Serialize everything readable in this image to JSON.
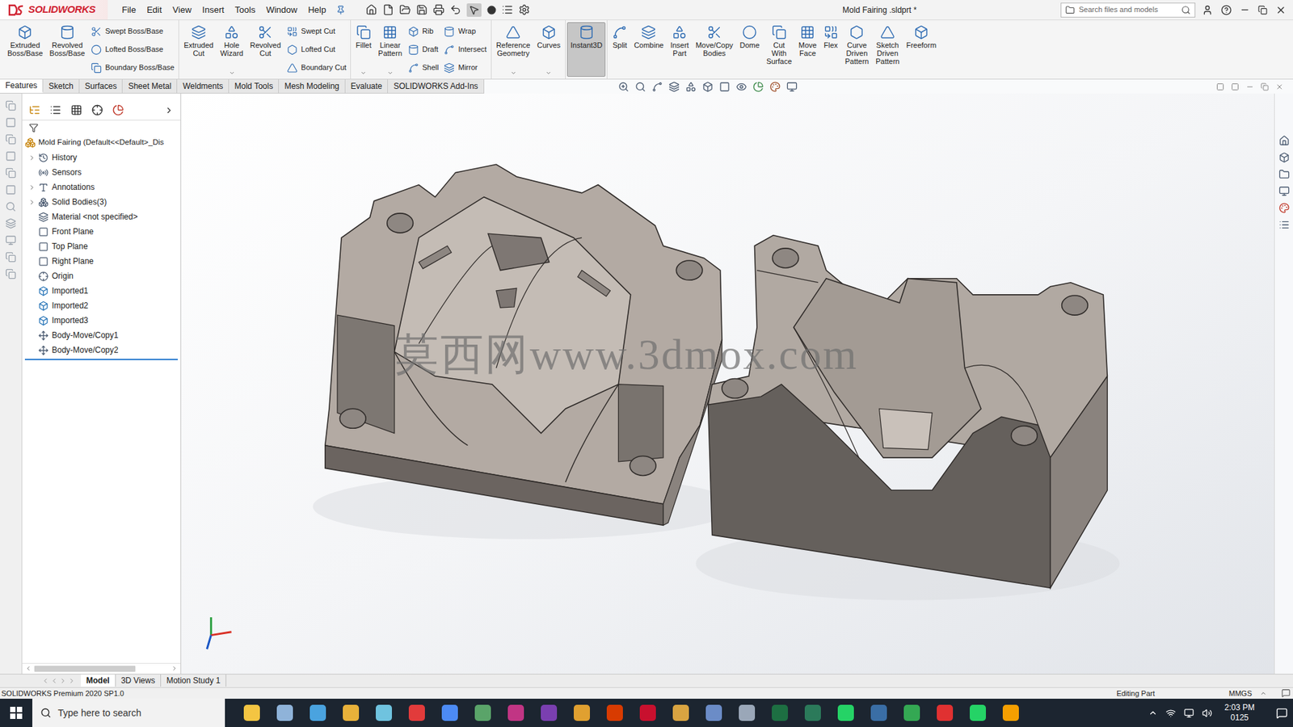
{
  "app": {
    "logo": "SOLIDWORKS"
  },
  "menu": [
    "File",
    "Edit",
    "View",
    "Insert",
    "Tools",
    "Window",
    "Help"
  ],
  "window": {
    "title": "Mold Fairing .sldprt *"
  },
  "search": {
    "placeholder": "Search files and models"
  },
  "ribbon": {
    "groups": [
      [
        {
          "kind": "large",
          "label": [
            "Extruded",
            "Boss/Base"
          ],
          "selected": false,
          "dropdown": false
        },
        {
          "kind": "large",
          "label": [
            "Revolved",
            "Boss/Base"
          ],
          "selected": false,
          "dropdown": false
        },
        {
          "kind": "stack",
          "items": [
            "Swept Boss/Base",
            "Lofted Boss/Base",
            "Boundary Boss/Base"
          ]
        }
      ],
      [
        {
          "kind": "large",
          "label": [
            "Extruded",
            "Cut"
          ],
          "selected": false,
          "dropdown": false
        },
        {
          "kind": "large",
          "label": [
            "Hole",
            "Wizard"
          ],
          "selected": false,
          "dropdown": true
        },
        {
          "kind": "large",
          "label": [
            "Revolved",
            "Cut"
          ],
          "selected": false,
          "dropdown": false
        },
        {
          "kind": "stack",
          "items": [
            "Swept Cut",
            "Lofted Cut",
            "Boundary Cut"
          ]
        }
      ],
      [
        {
          "kind": "large",
          "label": [
            "Fillet"
          ],
          "selected": false,
          "dropdown": true
        },
        {
          "kind": "large",
          "label": [
            "Linear",
            "Pattern"
          ],
          "selected": false,
          "dropdown": true
        },
        {
          "kind": "stack",
          "items": [
            "Rib",
            "Draft",
            "Shell"
          ]
        },
        {
          "kind": "stack",
          "items": [
            "Wrap",
            "Intersect",
            "Mirror"
          ]
        }
      ],
      [
        {
          "kind": "large",
          "label": [
            "Reference",
            "Geometry"
          ],
          "selected": false,
          "dropdown": true
        },
        {
          "kind": "large",
          "label": [
            "Curves"
          ],
          "selected": false,
          "dropdown": true
        }
      ],
      [
        {
          "kind": "large",
          "label": [
            "Instant3D"
          ],
          "selected": true,
          "dropdown": false
        }
      ],
      [
        {
          "kind": "large",
          "label": [
            "Split"
          ],
          "selected": false,
          "dropdown": false
        },
        {
          "kind": "large",
          "label": [
            "Combine"
          ],
          "selected": false,
          "dropdown": false
        },
        {
          "kind": "large",
          "label": [
            "Insert",
            "Part"
          ],
          "selected": false,
          "dropdown": false
        },
        {
          "kind": "large",
          "label": [
            "Move/Copy",
            "Bodies"
          ],
          "selected": false,
          "dropdown": false
        },
        {
          "kind": "large",
          "label": [
            "Dome"
          ],
          "selected": false,
          "dropdown": false
        },
        {
          "kind": "large",
          "label": [
            "Cut",
            "With",
            "Surface"
          ],
          "selected": false,
          "dropdown": false
        },
        {
          "kind": "large",
          "label": [
            "Move",
            "Face"
          ],
          "selected": false,
          "dropdown": false
        },
        {
          "kind": "large",
          "label": [
            "Flex"
          ],
          "selected": false,
          "dropdown": false
        },
        {
          "kind": "large",
          "label": [
            "Curve",
            "Driven",
            "Pattern"
          ],
          "selected": false,
          "dropdown": false
        },
        {
          "kind": "large",
          "label": [
            "Sketch",
            "Driven",
            "Pattern"
          ],
          "selected": false,
          "dropdown": false
        },
        {
          "kind": "large",
          "label": [
            "Freeform"
          ],
          "selected": false,
          "dropdown": false
        }
      ]
    ]
  },
  "tabs": [
    {
      "label": "Features",
      "selected": true
    },
    {
      "label": "Sketch",
      "selected": false
    },
    {
      "label": "Surfaces",
      "selected": false
    },
    {
      "label": "Sheet Metal",
      "selected": false
    },
    {
      "label": "Weldments",
      "selected": false
    },
    {
      "label": "Mold Tools",
      "selected": false
    },
    {
      "label": "Mesh Modeling",
      "selected": false
    },
    {
      "label": "Evaluate",
      "selected": false
    },
    {
      "label": "SOLIDWORKS Add-Ins",
      "selected": false
    }
  ],
  "feature_tree": {
    "root": "Mold Fairing (Default<<Default>_Dis",
    "items": [
      {
        "label": "History",
        "kind": "folder",
        "expandable": true
      },
      {
        "label": "Sensors",
        "kind": "sensor",
        "expandable": false
      },
      {
        "label": "Annotations",
        "kind": "annotation",
        "expandable": true
      },
      {
        "label": "Solid Bodies(3)",
        "kind": "bodies",
        "expandable": true
      },
      {
        "label": "Material <not specified>",
        "kind": "material",
        "expandable": false
      },
      {
        "label": "Front Plane",
        "kind": "plane",
        "expandable": false
      },
      {
        "label": "Top Plane",
        "kind": "plane",
        "expandable": false
      },
      {
        "label": "Right Plane",
        "kind": "plane",
        "expandable": false
      },
      {
        "label": "Origin",
        "kind": "origin",
        "expandable": false
      },
      {
        "label": "Imported1",
        "kind": "body",
        "expandable": false
      },
      {
        "label": "Imported2",
        "kind": "body",
        "expandable": false
      },
      {
        "label": "Imported3",
        "kind": "body",
        "expandable": false
      },
      {
        "label": "Body-Move/Copy1",
        "kind": "feature",
        "expandable": false
      },
      {
        "label": "Body-Move/Copy2",
        "kind": "feature",
        "expandable": false
      }
    ]
  },
  "watermark": "莫西网www.3dmox.com",
  "bottom_tabs": [
    {
      "label": "Model",
      "selected": true
    },
    {
      "label": "3D Views",
      "selected": false
    },
    {
      "label": "Motion Study 1",
      "selected": false
    }
  ],
  "status_bar": {
    "product": "SOLIDWORKS Premium 2020 SP1.0",
    "mode": "Editing Part",
    "units": "MMGS"
  },
  "taskbar": {
    "search_placeholder": "Type here to search",
    "time": "2:03 PM",
    "date": "0125"
  }
}
